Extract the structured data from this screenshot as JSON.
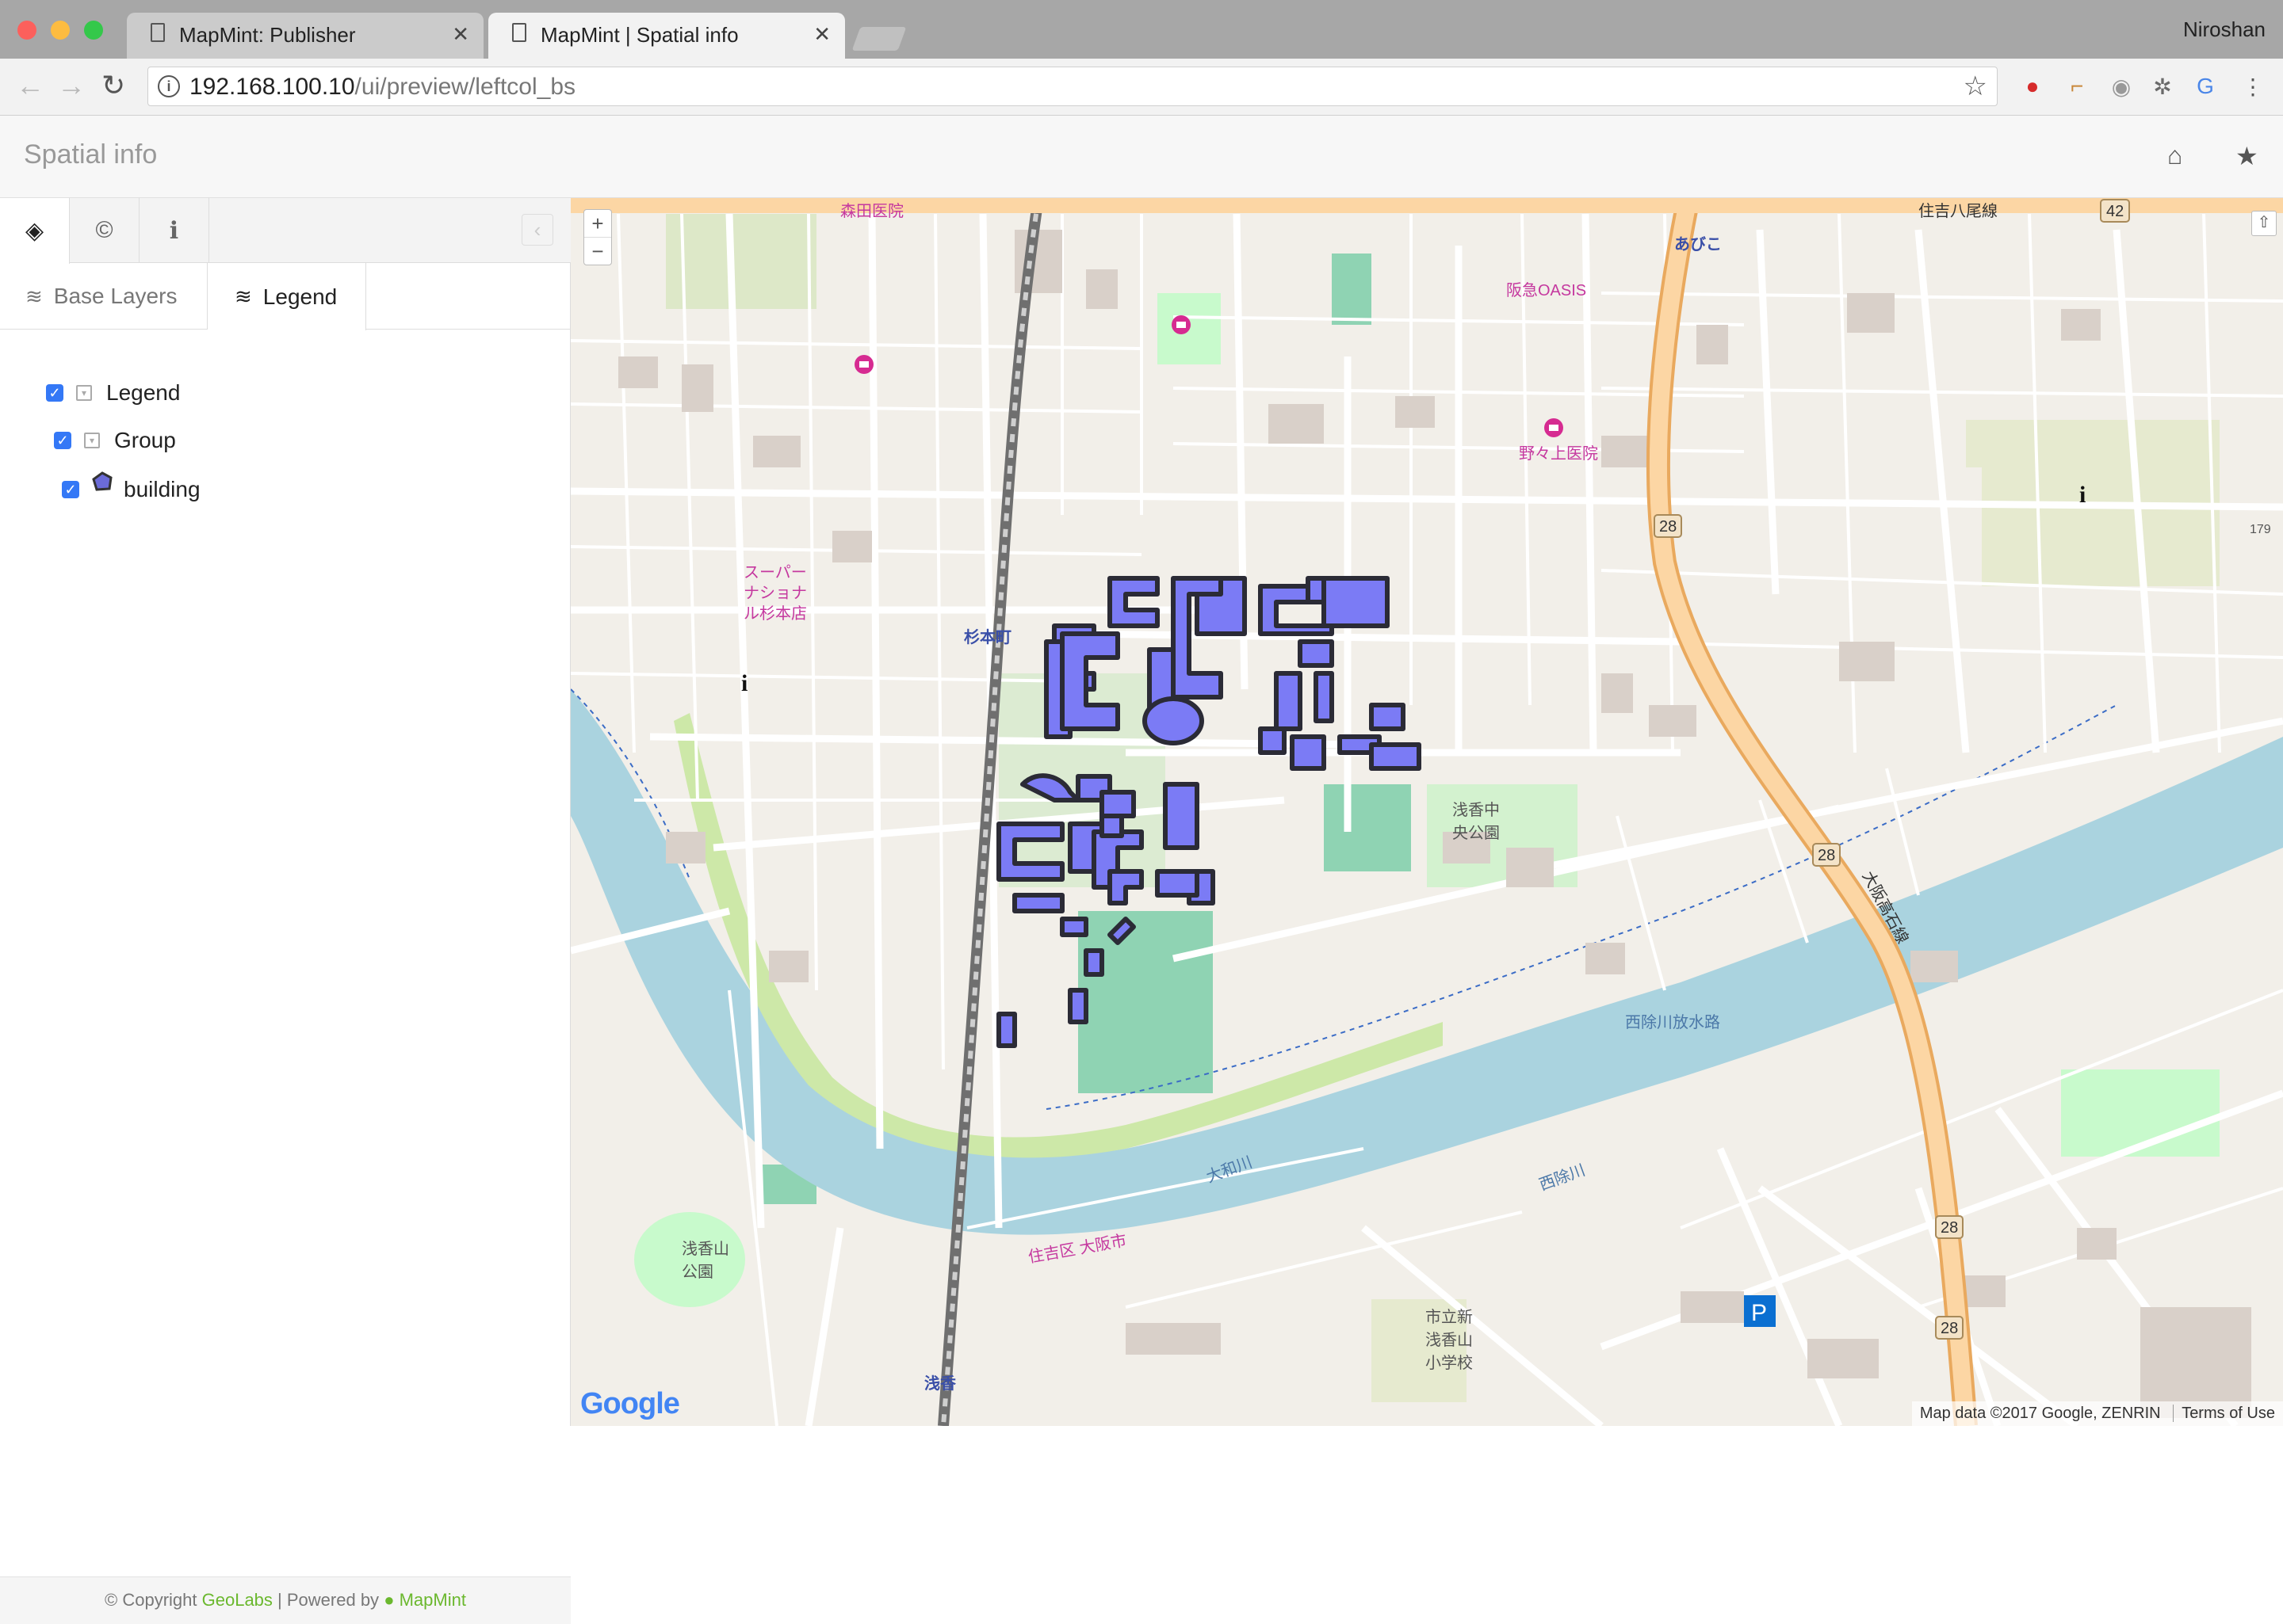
{
  "browser": {
    "tabs": [
      {
        "title": "MapMint: Publisher",
        "active": false
      },
      {
        "title": "MapMint | Spatial info",
        "active": true
      }
    ],
    "profile": "Niroshan",
    "url_host": "192.168.100.10",
    "url_path": "/ui/preview/leftcol_bs",
    "extension_icons": [
      "opera-icon",
      "bookmark-ribbon-icon",
      "camera-icon",
      "bug-icon",
      "translate-icon",
      "menu-dots-icon"
    ]
  },
  "app": {
    "title": "Spatial info",
    "header_icons": [
      "home-icon",
      "star-icon"
    ]
  },
  "sidebar": {
    "icon_tabs": [
      {
        "icon": "layers-icon",
        "glyph": "◈",
        "active": true
      },
      {
        "icon": "copyright-icon",
        "glyph": "©",
        "active": false
      },
      {
        "icon": "info-icon",
        "glyph": "ℹ",
        "active": false
      }
    ],
    "collapse_glyph": "‹",
    "sub_tabs": [
      {
        "label": "Base Layers",
        "active": false
      },
      {
        "label": "Legend",
        "active": true
      }
    ],
    "tree": [
      {
        "label": "Legend",
        "checked": true,
        "kind": "folder"
      },
      {
        "label": "Group",
        "checked": true,
        "kind": "folder"
      },
      {
        "label": "building",
        "checked": true,
        "kind": "layer"
      }
    ],
    "footer": {
      "copyright_prefix": "© Copyright",
      "geolabs": "GeoLabs",
      "separator": "| Powered by",
      "mapmint": "MapMint"
    }
  },
  "map": {
    "zoom_in": "+",
    "zoom_out": "−",
    "attribution": "Map data ©2017 Google, ZENRIN",
    "terms": "Terms of Use",
    "google_logo": "Google",
    "labels": [
      {
        "text": "森田医院",
        "color": "#c5389f"
      },
      {
        "text": "住吉八尾線",
        "color": "#333"
      },
      {
        "text": "42",
        "color": "#333"
      },
      {
        "text": "あびこ",
        "color": "#3a4fa8"
      },
      {
        "text": "阪急OASIS",
        "color": "#c5389f"
      },
      {
        "text": "野々上医院",
        "color": "#c5389f"
      },
      {
        "text": "杉本町",
        "color": "#3a4fa8"
      },
      {
        "text": "スーパーナショナル杉本店",
        "color": "#c5389f"
      },
      {
        "text": "浅香中央公園",
        "color": "#555"
      },
      {
        "text": "大和川",
        "color": "#4b78a8"
      },
      {
        "text": "西除川放水路",
        "color": "#4b78a8"
      },
      {
        "text": "大阪高石線",
        "color": "#333"
      },
      {
        "text": "28",
        "color": "#333"
      },
      {
        "text": "浅香山公園",
        "color": "#555"
      },
      {
        "text": "市立新浅香山小学校",
        "color": "#555"
      },
      {
        "text": "住吉区 大阪市",
        "color": "#c5389f"
      },
      {
        "text": "西除川",
        "color": "#4b78a8"
      },
      {
        "text": "浅香",
        "color": "#3a4fa8"
      },
      {
        "text": "179",
        "color": "#555"
      }
    ],
    "colors": {
      "building_fill": "#7b7bf5",
      "building_stroke": "#2b2b36",
      "river": "#aad3df",
      "highway": "#fcd6a4",
      "park": "#c8facc",
      "base": "#f2efe9"
    }
  }
}
